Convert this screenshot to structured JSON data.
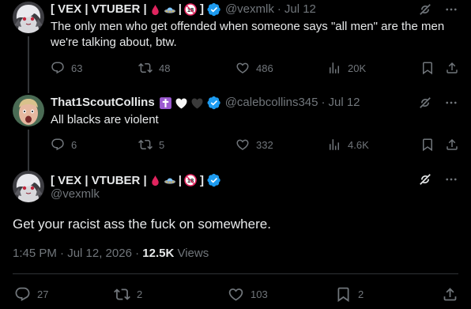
{
  "tweets": [
    {
      "display_name": "[ VEX | VTUBER |",
      "name_suffix": "]",
      "emojis": [
        "blood-drop",
        "ufo",
        "18-plus"
      ],
      "handle": "@vexmlk",
      "time": "Jul 12",
      "text": "The only men who get offended when someone says \"all men\" are the men we're talking about, btw.",
      "replies": "63",
      "reposts": "48",
      "likes": "486",
      "views": "20K"
    },
    {
      "display_name": "That1ScoutCollins",
      "emojis": [
        "latin-cross",
        "white-heart",
        "black-heart"
      ],
      "handle": "@calebcollins345",
      "time": "Jul 12",
      "text": "All blacks are violent",
      "replies": "6",
      "reposts": "5",
      "likes": "332",
      "views": "4.6K"
    }
  ],
  "main": {
    "display_name": "[ VEX | VTUBER |",
    "name_suffix": "]",
    "handle": "@vexmlk",
    "text": "Get your racist ass the fuck on somewhere.",
    "timestamp": "1:45 PM · Jul 12, 2026 ·",
    "views_count": "12.5K",
    "views_label": "Views",
    "replies": "27",
    "reposts": "2",
    "likes": "103",
    "bookmarks": "2"
  },
  "separator": "·",
  "colors": {
    "background": "#000000",
    "text": "#e7e9ea",
    "muted": "#71767b",
    "verified": "#1d9bf0",
    "divider": "#2f3336"
  }
}
